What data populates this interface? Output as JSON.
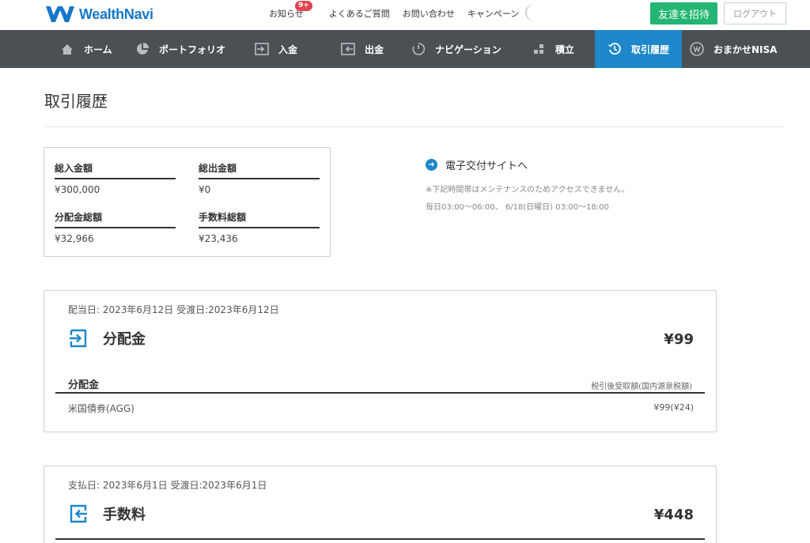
{
  "header": {
    "logo_text": "WealthNavi",
    "links": [
      "お知らせ",
      "よくあるご質問",
      "お問い合わせ",
      "キャンペーン"
    ],
    "notice_badge": "9+",
    "invite_label": "友達を招待",
    "logout_label": "ログアウト"
  },
  "nav": {
    "items": [
      {
        "label": "ホーム",
        "icon": "home-icon"
      },
      {
        "label": "ポートフォリオ",
        "icon": "pie-chart-icon"
      },
      {
        "label": "入金",
        "icon": "deposit-icon"
      },
      {
        "label": "出金",
        "icon": "withdraw-icon"
      },
      {
        "label": "ナビゲーション",
        "icon": "navigation-icon"
      },
      {
        "label": "積立",
        "icon": "blocks-icon"
      },
      {
        "label": "取引履歴",
        "icon": "history-icon",
        "active": true
      },
      {
        "label": "おまかせNISA",
        "icon": "nisa-icon"
      }
    ]
  },
  "page": {
    "title": "取引履歴"
  },
  "summary": {
    "total_deposit_label": "総入金額",
    "total_deposit_value": "¥300,000",
    "total_withdraw_label": "総出金額",
    "total_withdraw_value": "¥0",
    "total_dividend_label": "分配金総額",
    "total_dividend_value": "¥32,966",
    "total_fee_label": "手数料総額",
    "total_fee_value": "¥23,436"
  },
  "denshi": {
    "link_label": "電子交付サイトへ",
    "maintenance_note": "※下記時間帯はメンテナンスのためアクセスできません。",
    "maintenance_hours": "毎日03:00〜06:00、 6/18(日曜日) 03:00〜18:00"
  },
  "transactions": [
    {
      "date_line": "配当日: 2023年6月12日 受渡日:2023年6月12日",
      "name": "分配金",
      "amount": "¥99",
      "sub_title": "分配金",
      "sub_note": "税引後受取額(国内源泉税額)",
      "row_name": "米国債券(AGG)",
      "row_value": "¥99(¥24)"
    },
    {
      "date_line": "支払日: 2023年6月1日 受渡日:2023年6月1日",
      "name": "手数料",
      "amount": "¥448"
    }
  ],
  "colors": {
    "brand_blue": "#1677c9",
    "nav_bg": "#4b5055",
    "nav_active": "#1d87c9",
    "invite_green": "#22b573",
    "badge_red": "#e0454e"
  }
}
